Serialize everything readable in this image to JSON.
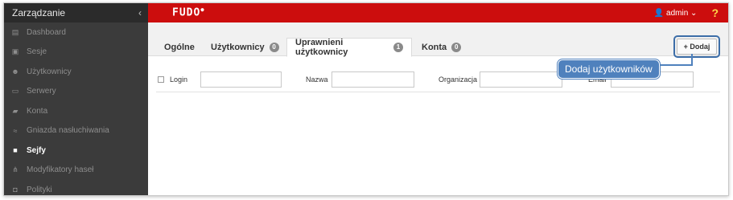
{
  "sidebar": {
    "title": "Zarządzanie",
    "collapse_icon": "chevron-left-icon",
    "collapse_glyph": "‹",
    "items": [
      {
        "label": "Dashboard",
        "icon": "chart-icon",
        "glyph": "▤",
        "active": false
      },
      {
        "label": "Sesje",
        "icon": "film-icon",
        "glyph": "▣",
        "active": false
      },
      {
        "label": "Użytkownicy",
        "icon": "users-icon",
        "glyph": "☻",
        "active": false
      },
      {
        "label": "Serwery",
        "icon": "server-icon",
        "glyph": "▭",
        "active": false
      },
      {
        "label": "Konta",
        "icon": "account-icon",
        "glyph": "▰",
        "active": false
      },
      {
        "label": "Gniazda nasłuchiwania",
        "icon": "rss-icon",
        "glyph": "≈",
        "active": false
      },
      {
        "label": "Sejfy",
        "icon": "safe-icon",
        "glyph": "■",
        "active": true
      },
      {
        "label": "Modyfikatory haseł",
        "icon": "sitemap-icon",
        "glyph": "⋔",
        "active": false
      },
      {
        "label": "Polityki",
        "icon": "shield-icon",
        "glyph": "◘",
        "active": false
      }
    ]
  },
  "topbar": {
    "logo": "FUDO",
    "user_label": "admin",
    "user_icon": "user-icon",
    "dropdown_glyph": "⌄",
    "help_label": "?"
  },
  "tabs": [
    {
      "label": "Ogólne",
      "badge": null,
      "active": false
    },
    {
      "label": "Użytkownicy",
      "badge": "0",
      "active": false
    },
    {
      "label": "Uprawnieni użytkownicy",
      "badge": "1",
      "active": true
    },
    {
      "label": "Konta",
      "badge": "0",
      "active": false
    }
  ],
  "add_button": {
    "label": "+ Dodaj"
  },
  "filters": {
    "login_label": "Login",
    "name_label": "Nazwa",
    "org_label": "Organizacja",
    "email_label": "Email"
  },
  "tooltip": {
    "text": "Dodaj użytkowników"
  },
  "colors": {
    "accent": "#cc0d0d",
    "sidebar_bg": "#3b3b3b",
    "callout": "#4f81bd"
  }
}
